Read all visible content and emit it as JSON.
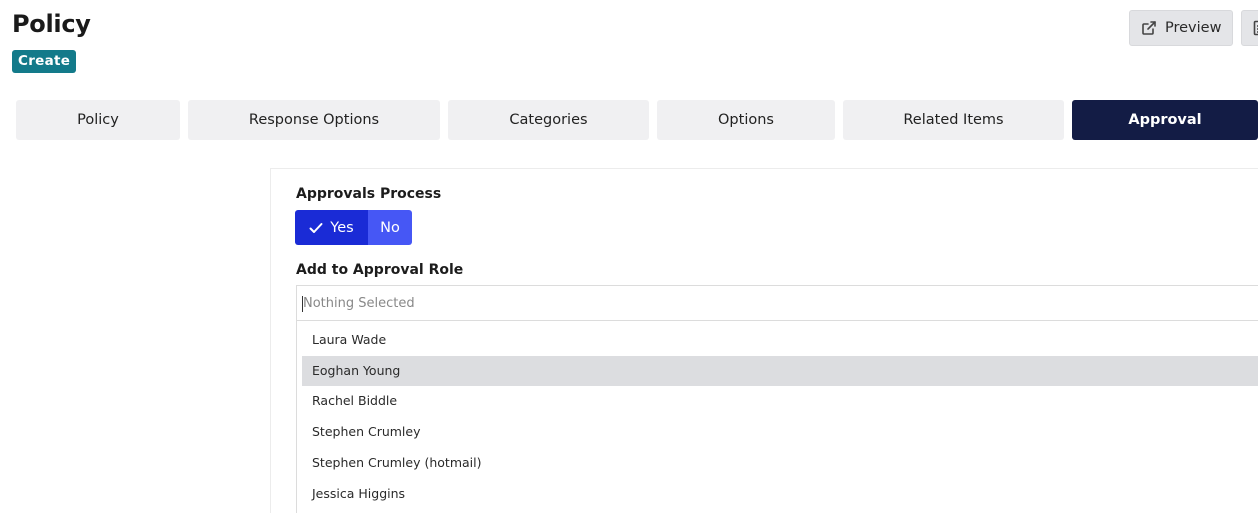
{
  "header": {
    "title": "Policy",
    "mode_badge": "Create",
    "preview_label": "Preview"
  },
  "icons": {
    "preview": "external-link-icon",
    "extra": "document-icon",
    "check": "checkmark-icon"
  },
  "tabs": [
    {
      "label": "Policy"
    },
    {
      "label": "Response Options"
    },
    {
      "label": "Categories"
    },
    {
      "label": "Options"
    },
    {
      "label": "Related Items"
    },
    {
      "label": "Approval",
      "active": true
    }
  ],
  "approval": {
    "process_label": "Approvals Process",
    "yes_label": "Yes",
    "no_label": "No",
    "selected": "Yes",
    "role_label": "Add to Approval Role",
    "role_placeholder": "Nothing Selected",
    "options": [
      {
        "label": "Laura Wade"
      },
      {
        "label": "Eoghan Young",
        "highlighted": true
      },
      {
        "label": "Rachel Biddle"
      },
      {
        "label": "Stephen Crumley"
      },
      {
        "label": "Stephen Crumley (hotmail)"
      },
      {
        "label": "Jessica Higgins"
      }
    ]
  },
  "colors": {
    "badge": "#137a8a",
    "active_tab": "#131c45",
    "toggle_yes": "#1a2bd6",
    "toggle_no": "#4657f5",
    "option_hover": "#dcdde0"
  }
}
